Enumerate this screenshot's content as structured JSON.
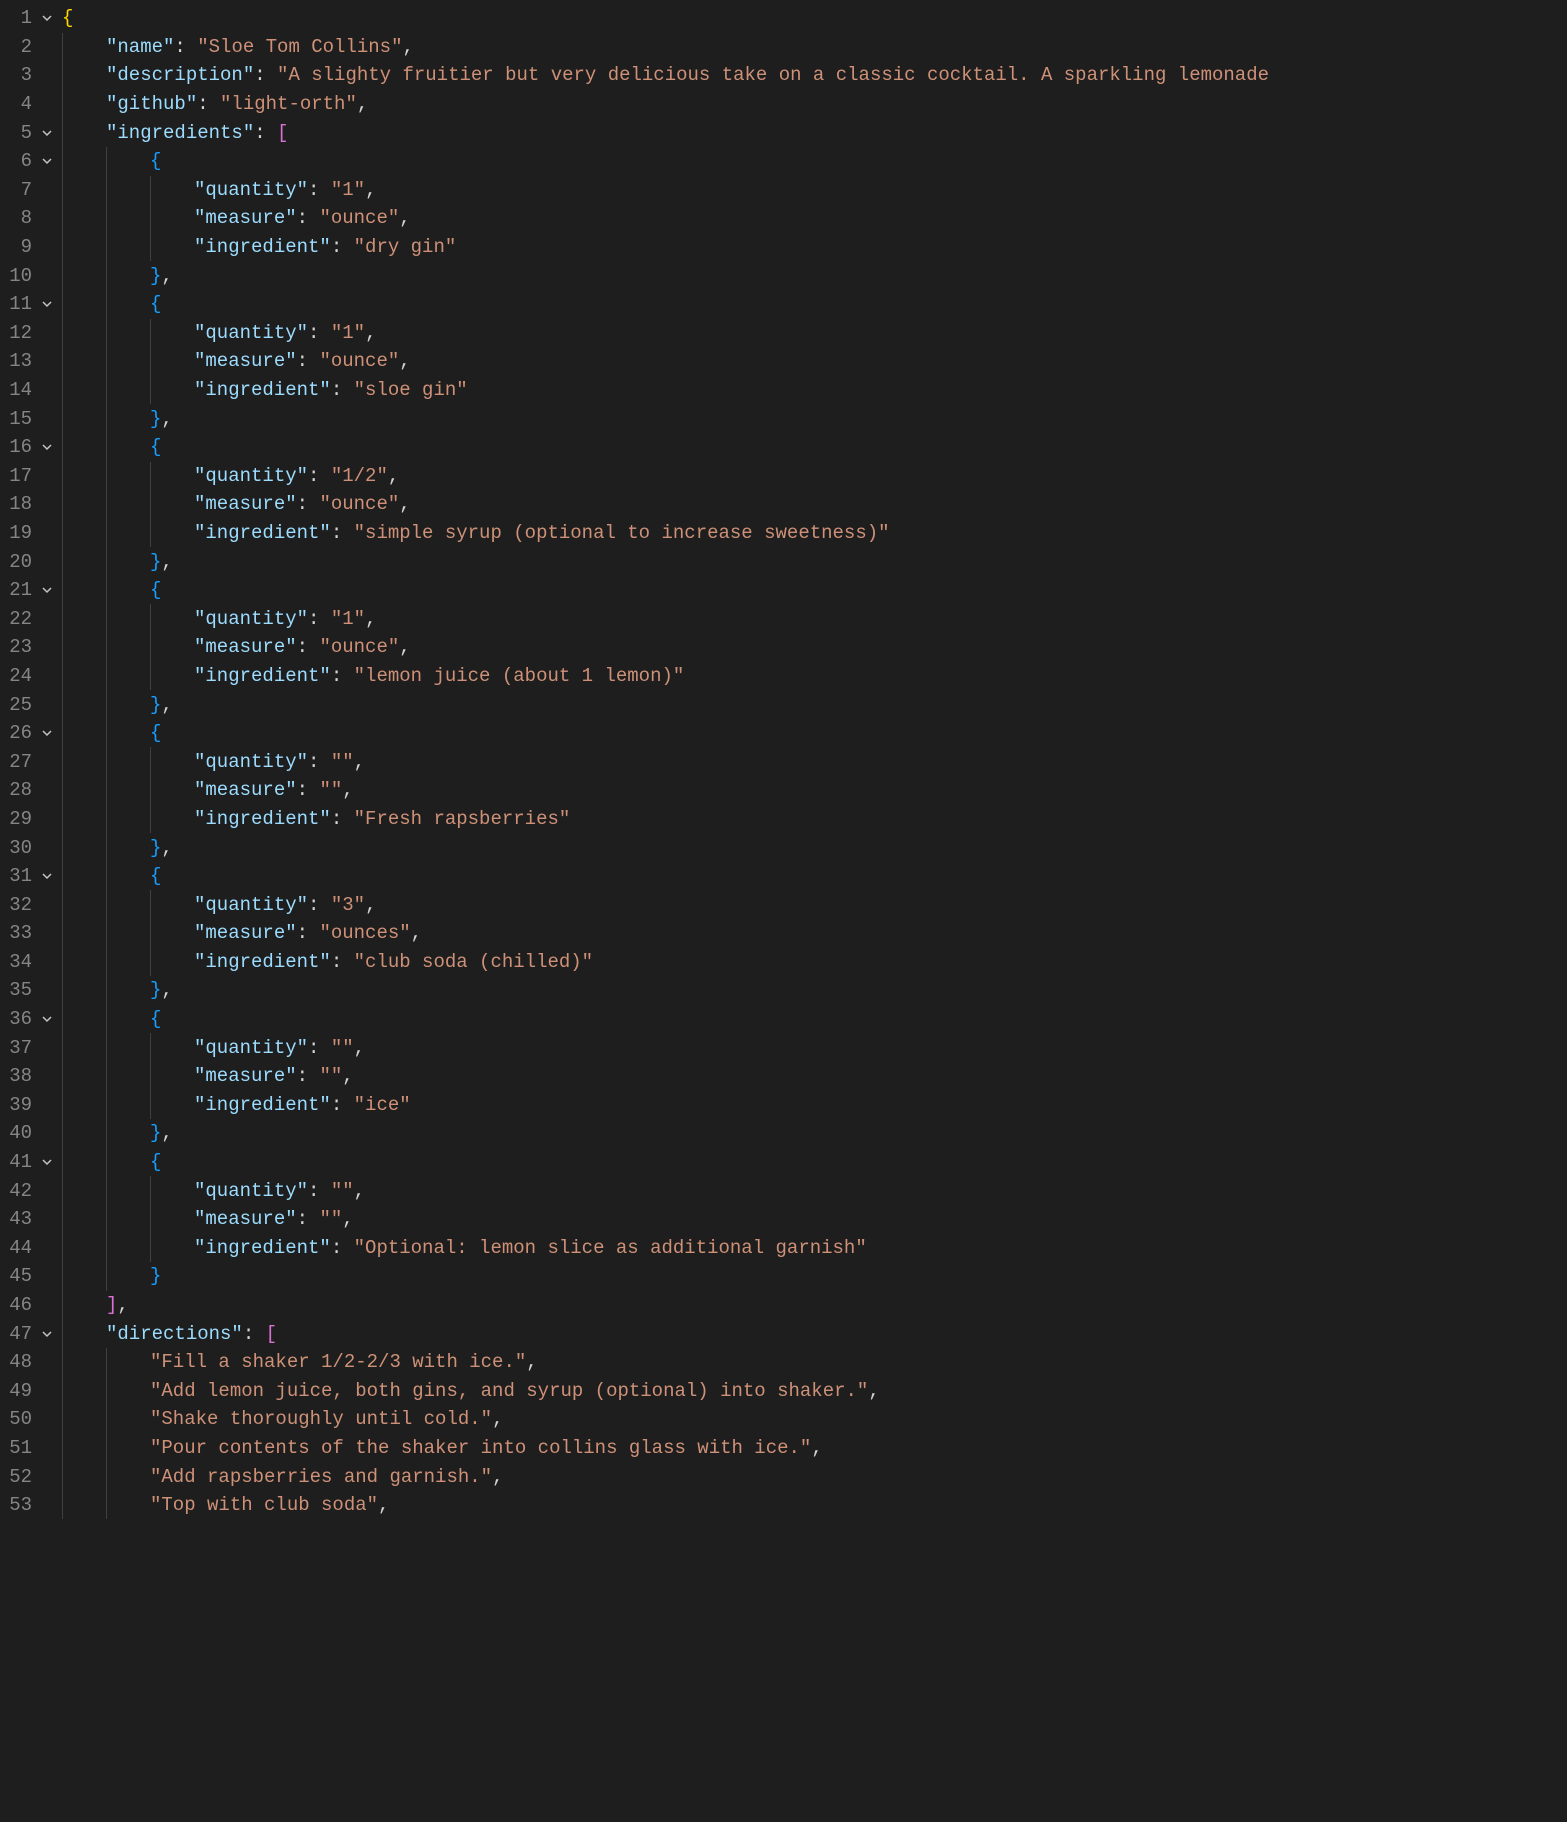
{
  "lines": [
    {
      "n": 1,
      "fold": true,
      "indent": 0,
      "tokens": [
        [
          "brace",
          "{"
        ]
      ]
    },
    {
      "n": 2,
      "fold": false,
      "indent": 1,
      "guides": [
        0
      ],
      "tokens": [
        [
          "key",
          "\"name\""
        ],
        [
          "punct",
          ": "
        ],
        [
          "string",
          "\"Sloe Tom Collins\""
        ],
        [
          "punct",
          ","
        ]
      ]
    },
    {
      "n": 3,
      "fold": false,
      "indent": 1,
      "guides": [
        0
      ],
      "tokens": [
        [
          "key",
          "\"description\""
        ],
        [
          "punct",
          ": "
        ],
        [
          "string",
          "\"A slighty fruitier but very delicious take on a classic cocktail. A sparkling lemonade "
        ]
      ]
    },
    {
      "n": 4,
      "fold": false,
      "indent": 1,
      "guides": [
        0
      ],
      "tokens": [
        [
          "key",
          "\"github\""
        ],
        [
          "punct",
          ": "
        ],
        [
          "string",
          "\"light-orth\""
        ],
        [
          "punct",
          ","
        ]
      ]
    },
    {
      "n": 5,
      "fold": true,
      "indent": 1,
      "guides": [
        0
      ],
      "tokens": [
        [
          "key",
          "\"ingredients\""
        ],
        [
          "punct",
          ": "
        ],
        [
          "bracket",
          "["
        ]
      ]
    },
    {
      "n": 6,
      "fold": true,
      "indent": 2,
      "guides": [
        0,
        1
      ],
      "tokens": [
        [
          "bracket2",
          "{"
        ]
      ]
    },
    {
      "n": 7,
      "fold": false,
      "indent": 3,
      "guides": [
        0,
        1,
        2
      ],
      "tokens": [
        [
          "key",
          "\"quantity\""
        ],
        [
          "punct",
          ": "
        ],
        [
          "string",
          "\"1\""
        ],
        [
          "punct",
          ","
        ]
      ]
    },
    {
      "n": 8,
      "fold": false,
      "indent": 3,
      "guides": [
        0,
        1,
        2
      ],
      "tokens": [
        [
          "key",
          "\"measure\""
        ],
        [
          "punct",
          ": "
        ],
        [
          "string",
          "\"ounce\""
        ],
        [
          "punct",
          ","
        ]
      ]
    },
    {
      "n": 9,
      "fold": false,
      "indent": 3,
      "guides": [
        0,
        1,
        2
      ],
      "tokens": [
        [
          "key",
          "\"ingredient\""
        ],
        [
          "punct",
          ": "
        ],
        [
          "string",
          "\"dry gin\""
        ]
      ]
    },
    {
      "n": 10,
      "fold": false,
      "indent": 2,
      "guides": [
        0,
        1
      ],
      "tokens": [
        [
          "bracket2",
          "}"
        ],
        [
          "punct",
          ","
        ]
      ]
    },
    {
      "n": 11,
      "fold": true,
      "indent": 2,
      "guides": [
        0,
        1
      ],
      "tokens": [
        [
          "bracket2",
          "{"
        ]
      ]
    },
    {
      "n": 12,
      "fold": false,
      "indent": 3,
      "guides": [
        0,
        1,
        2
      ],
      "tokens": [
        [
          "key",
          "\"quantity\""
        ],
        [
          "punct",
          ": "
        ],
        [
          "string",
          "\"1\""
        ],
        [
          "punct",
          ","
        ]
      ]
    },
    {
      "n": 13,
      "fold": false,
      "indent": 3,
      "guides": [
        0,
        1,
        2
      ],
      "tokens": [
        [
          "key",
          "\"measure\""
        ],
        [
          "punct",
          ": "
        ],
        [
          "string",
          "\"ounce\""
        ],
        [
          "punct",
          ","
        ]
      ]
    },
    {
      "n": 14,
      "fold": false,
      "indent": 3,
      "guides": [
        0,
        1,
        2
      ],
      "tokens": [
        [
          "key",
          "\"ingredient\""
        ],
        [
          "punct",
          ": "
        ],
        [
          "string",
          "\"sloe gin\""
        ]
      ]
    },
    {
      "n": 15,
      "fold": false,
      "indent": 2,
      "guides": [
        0,
        1
      ],
      "tokens": [
        [
          "bracket2",
          "}"
        ],
        [
          "punct",
          ","
        ]
      ]
    },
    {
      "n": 16,
      "fold": true,
      "indent": 2,
      "guides": [
        0,
        1
      ],
      "tokens": [
        [
          "bracket2",
          "{"
        ]
      ]
    },
    {
      "n": 17,
      "fold": false,
      "indent": 3,
      "guides": [
        0,
        1,
        2
      ],
      "tokens": [
        [
          "key",
          "\"quantity\""
        ],
        [
          "punct",
          ": "
        ],
        [
          "string",
          "\"1/2\""
        ],
        [
          "punct",
          ","
        ]
      ]
    },
    {
      "n": 18,
      "fold": false,
      "indent": 3,
      "guides": [
        0,
        1,
        2
      ],
      "tokens": [
        [
          "key",
          "\"measure\""
        ],
        [
          "punct",
          ": "
        ],
        [
          "string",
          "\"ounce\""
        ],
        [
          "punct",
          ","
        ]
      ]
    },
    {
      "n": 19,
      "fold": false,
      "indent": 3,
      "guides": [
        0,
        1,
        2
      ],
      "tokens": [
        [
          "key",
          "\"ingredient\""
        ],
        [
          "punct",
          ": "
        ],
        [
          "string",
          "\"simple syrup (optional to increase sweetness)\""
        ]
      ]
    },
    {
      "n": 20,
      "fold": false,
      "indent": 2,
      "guides": [
        0,
        1
      ],
      "tokens": [
        [
          "bracket2",
          "}"
        ],
        [
          "punct",
          ","
        ]
      ]
    },
    {
      "n": 21,
      "fold": true,
      "indent": 2,
      "guides": [
        0,
        1
      ],
      "tokens": [
        [
          "bracket2",
          "{"
        ]
      ]
    },
    {
      "n": 22,
      "fold": false,
      "indent": 3,
      "guides": [
        0,
        1,
        2
      ],
      "tokens": [
        [
          "key",
          "\"quantity\""
        ],
        [
          "punct",
          ": "
        ],
        [
          "string",
          "\"1\""
        ],
        [
          "punct",
          ","
        ]
      ]
    },
    {
      "n": 23,
      "fold": false,
      "indent": 3,
      "guides": [
        0,
        1,
        2
      ],
      "tokens": [
        [
          "key",
          "\"measure\""
        ],
        [
          "punct",
          ": "
        ],
        [
          "string",
          "\"ounce\""
        ],
        [
          "punct",
          ","
        ]
      ]
    },
    {
      "n": 24,
      "fold": false,
      "indent": 3,
      "guides": [
        0,
        1,
        2
      ],
      "tokens": [
        [
          "key",
          "\"ingredient\""
        ],
        [
          "punct",
          ": "
        ],
        [
          "string",
          "\"lemon juice (about 1 lemon)\""
        ]
      ]
    },
    {
      "n": 25,
      "fold": false,
      "indent": 2,
      "guides": [
        0,
        1
      ],
      "tokens": [
        [
          "bracket2",
          "}"
        ],
        [
          "punct",
          ","
        ]
      ]
    },
    {
      "n": 26,
      "fold": true,
      "indent": 2,
      "guides": [
        0,
        1
      ],
      "tokens": [
        [
          "bracket2",
          "{"
        ]
      ]
    },
    {
      "n": 27,
      "fold": false,
      "indent": 3,
      "guides": [
        0,
        1,
        2
      ],
      "tokens": [
        [
          "key",
          "\"quantity\""
        ],
        [
          "punct",
          ": "
        ],
        [
          "string",
          "\"\""
        ],
        [
          "punct",
          ","
        ]
      ]
    },
    {
      "n": 28,
      "fold": false,
      "indent": 3,
      "guides": [
        0,
        1,
        2
      ],
      "tokens": [
        [
          "key",
          "\"measure\""
        ],
        [
          "punct",
          ": "
        ],
        [
          "string",
          "\"\""
        ],
        [
          "punct",
          ","
        ]
      ]
    },
    {
      "n": 29,
      "fold": false,
      "indent": 3,
      "guides": [
        0,
        1,
        2
      ],
      "tokens": [
        [
          "key",
          "\"ingredient\""
        ],
        [
          "punct",
          ": "
        ],
        [
          "string",
          "\"Fresh rapsberries\""
        ]
      ]
    },
    {
      "n": 30,
      "fold": false,
      "indent": 2,
      "guides": [
        0,
        1
      ],
      "tokens": [
        [
          "bracket2",
          "}"
        ],
        [
          "punct",
          ","
        ]
      ]
    },
    {
      "n": 31,
      "fold": true,
      "indent": 2,
      "guides": [
        0,
        1
      ],
      "tokens": [
        [
          "bracket2",
          "{"
        ]
      ]
    },
    {
      "n": 32,
      "fold": false,
      "indent": 3,
      "guides": [
        0,
        1,
        2
      ],
      "tokens": [
        [
          "key",
          "\"quantity\""
        ],
        [
          "punct",
          ": "
        ],
        [
          "string",
          "\"3\""
        ],
        [
          "punct",
          ","
        ]
      ]
    },
    {
      "n": 33,
      "fold": false,
      "indent": 3,
      "guides": [
        0,
        1,
        2
      ],
      "tokens": [
        [
          "key",
          "\"measure\""
        ],
        [
          "punct",
          ": "
        ],
        [
          "string",
          "\"ounces\""
        ],
        [
          "punct",
          ","
        ]
      ]
    },
    {
      "n": 34,
      "fold": false,
      "indent": 3,
      "guides": [
        0,
        1,
        2
      ],
      "tokens": [
        [
          "key",
          "\"ingredient\""
        ],
        [
          "punct",
          ": "
        ],
        [
          "string",
          "\"club soda (chilled)\""
        ]
      ]
    },
    {
      "n": 35,
      "fold": false,
      "indent": 2,
      "guides": [
        0,
        1
      ],
      "tokens": [
        [
          "bracket2",
          "}"
        ],
        [
          "punct",
          ","
        ]
      ]
    },
    {
      "n": 36,
      "fold": true,
      "indent": 2,
      "guides": [
        0,
        1
      ],
      "tokens": [
        [
          "bracket2",
          "{"
        ]
      ]
    },
    {
      "n": 37,
      "fold": false,
      "indent": 3,
      "guides": [
        0,
        1,
        2
      ],
      "tokens": [
        [
          "key",
          "\"quantity\""
        ],
        [
          "punct",
          ": "
        ],
        [
          "string",
          "\"\""
        ],
        [
          "punct",
          ","
        ]
      ]
    },
    {
      "n": 38,
      "fold": false,
      "indent": 3,
      "guides": [
        0,
        1,
        2
      ],
      "tokens": [
        [
          "key",
          "\"measure\""
        ],
        [
          "punct",
          ": "
        ],
        [
          "string",
          "\"\""
        ],
        [
          "punct",
          ","
        ]
      ]
    },
    {
      "n": 39,
      "fold": false,
      "indent": 3,
      "guides": [
        0,
        1,
        2
      ],
      "tokens": [
        [
          "key",
          "\"ingredient\""
        ],
        [
          "punct",
          ": "
        ],
        [
          "string",
          "\"ice\""
        ]
      ]
    },
    {
      "n": 40,
      "fold": false,
      "indent": 2,
      "guides": [
        0,
        1
      ],
      "tokens": [
        [
          "bracket2",
          "}"
        ],
        [
          "punct",
          ","
        ]
      ]
    },
    {
      "n": 41,
      "fold": true,
      "indent": 2,
      "guides": [
        0,
        1
      ],
      "tokens": [
        [
          "bracket2",
          "{"
        ]
      ]
    },
    {
      "n": 42,
      "fold": false,
      "indent": 3,
      "guides": [
        0,
        1,
        2
      ],
      "tokens": [
        [
          "key",
          "\"quantity\""
        ],
        [
          "punct",
          ": "
        ],
        [
          "string",
          "\"\""
        ],
        [
          "punct",
          ","
        ]
      ]
    },
    {
      "n": 43,
      "fold": false,
      "indent": 3,
      "guides": [
        0,
        1,
        2
      ],
      "tokens": [
        [
          "key",
          "\"measure\""
        ],
        [
          "punct",
          ": "
        ],
        [
          "string",
          "\"\""
        ],
        [
          "punct",
          ","
        ]
      ]
    },
    {
      "n": 44,
      "fold": false,
      "indent": 3,
      "guides": [
        0,
        1,
        2
      ],
      "tokens": [
        [
          "key",
          "\"ingredient\""
        ],
        [
          "punct",
          ": "
        ],
        [
          "string",
          "\"Optional: lemon slice as additional garnish\""
        ]
      ]
    },
    {
      "n": 45,
      "fold": false,
      "indent": 2,
      "guides": [
        0,
        1
      ],
      "tokens": [
        [
          "bracket2",
          "}"
        ]
      ]
    },
    {
      "n": 46,
      "fold": false,
      "indent": 1,
      "guides": [
        0
      ],
      "tokens": [
        [
          "bracket",
          "]"
        ],
        [
          "punct",
          ","
        ]
      ]
    },
    {
      "n": 47,
      "fold": true,
      "indent": 1,
      "guides": [
        0
      ],
      "tokens": [
        [
          "key",
          "\"directions\""
        ],
        [
          "punct",
          ": "
        ],
        [
          "bracket",
          "["
        ]
      ]
    },
    {
      "n": 48,
      "fold": false,
      "indent": 2,
      "guides": [
        0,
        1
      ],
      "tokens": [
        [
          "string",
          "\"Fill a shaker 1/2-2/3 with ice.\""
        ],
        [
          "punct",
          ","
        ]
      ]
    },
    {
      "n": 49,
      "fold": false,
      "indent": 2,
      "guides": [
        0,
        1
      ],
      "tokens": [
        [
          "string",
          "\"Add lemon juice, both gins, and syrup (optional) into shaker.\""
        ],
        [
          "punct",
          ","
        ]
      ]
    },
    {
      "n": 50,
      "fold": false,
      "indent": 2,
      "guides": [
        0,
        1
      ],
      "tokens": [
        [
          "string",
          "\"Shake thoroughly until cold.\""
        ],
        [
          "punct",
          ","
        ]
      ]
    },
    {
      "n": 51,
      "fold": false,
      "indent": 2,
      "guides": [
        0,
        1
      ],
      "tokens": [
        [
          "string",
          "\"Pour contents of the shaker into collins glass with ice.\""
        ],
        [
          "punct",
          ","
        ]
      ]
    },
    {
      "n": 52,
      "fold": false,
      "indent": 2,
      "guides": [
        0,
        1
      ],
      "tokens": [
        [
          "string",
          "\"Add rapsberries and garnish.\""
        ],
        [
          "punct",
          ","
        ]
      ]
    },
    {
      "n": 53,
      "fold": false,
      "indent": 2,
      "guides": [
        0,
        1
      ],
      "tokens": [
        [
          "string",
          "\"Top with club soda\""
        ],
        [
          "punct",
          ","
        ]
      ]
    }
  ],
  "indent_width": 44,
  "tok_class": {
    "brace": "tok-brace",
    "bracket": "tok-bracket",
    "bracket2": "tok-bracket2",
    "key": "tok-key",
    "string": "tok-string",
    "punct": "tok-punct"
  }
}
